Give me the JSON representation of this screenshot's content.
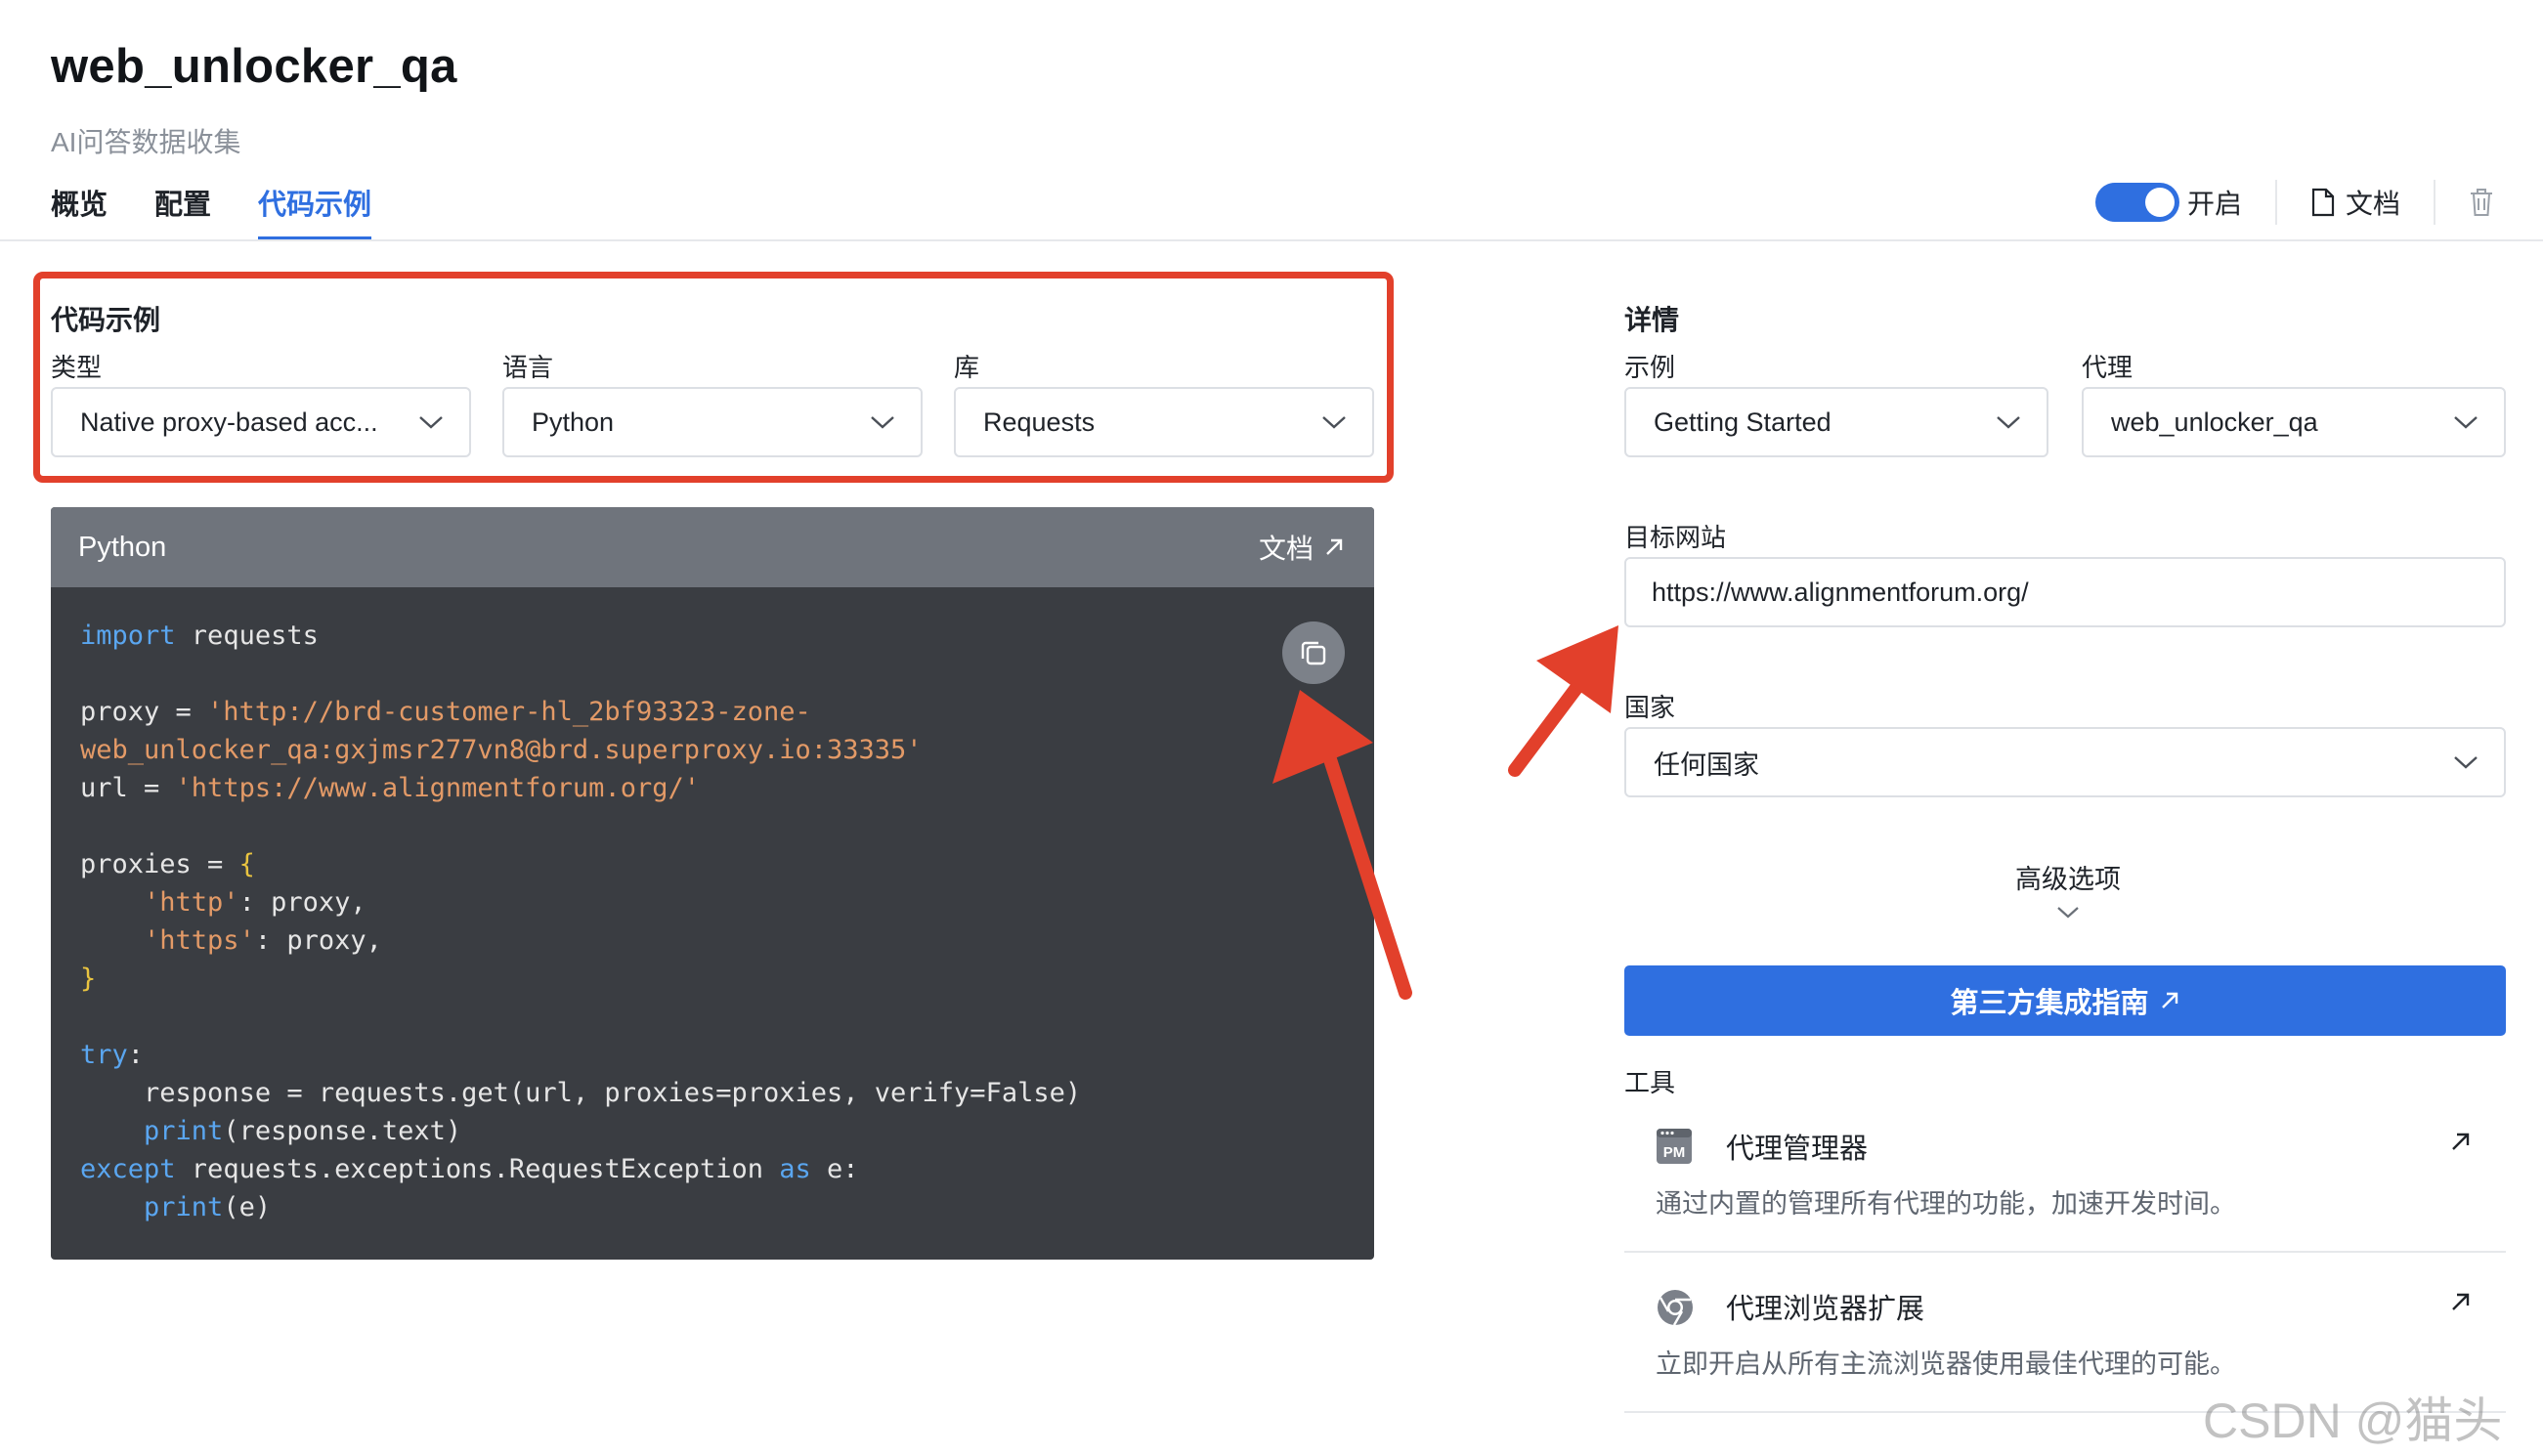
{
  "page": {
    "title": "web_unlocker_qa",
    "subtitle": "AI问答数据收集"
  },
  "tabs": [
    {
      "label": "概览"
    },
    {
      "label": "配置"
    },
    {
      "label": "代码示例"
    }
  ],
  "header_actions": {
    "toggle_label": "开启",
    "toggle_on": true,
    "doc_label": "文档"
  },
  "code_example": {
    "section_title": "代码示例",
    "type_label": "类型",
    "type_value": "Native proxy-based acc...",
    "language_label": "语言",
    "language_value": "Python",
    "library_label": "库",
    "library_value": "Requests",
    "panel_lang": "Python",
    "panel_doc_label": "文档",
    "code": {
      "l1_kw": "import",
      "l1_rest": " requests",
      "l3_a": "proxy = ",
      "l3_str": "'http://brd-customer-hl_2bf93323-zone-",
      "l4_str": "web_unlocker_qa:gxjmsr277vn8@brd.superproxy.io:33335'",
      "l5_a": "url = ",
      "l5_str": "'https://www.alignmentforum.org/'",
      "l7_a": "proxies = ",
      "l7_br": "{",
      "l8_str": "'http'",
      "l8_rest": ": proxy,",
      "l9_str": "'https'",
      "l9_rest": ": proxy,",
      "l10_br": "}",
      "l12_kw": "try",
      "l12_rest": ":",
      "l13": "response = requests.get(url, proxies=proxies, verify=False)",
      "l14_kw": "print",
      "l14_rest": "(response.text)",
      "l15_kw": "except",
      "l15_a": " requests.exceptions.RequestException ",
      "l15_kw2": "as",
      "l15_b": " e:",
      "l16_kw": "print",
      "l16_rest": "(e)"
    }
  },
  "details": {
    "section_title": "详情",
    "example_label": "示例",
    "example_value": "Getting Started",
    "proxy_label": "代理",
    "proxy_value": "web_unlocker_qa",
    "target_label": "目标网站",
    "target_value": "https://www.alignmentforum.org/",
    "country_label": "国家",
    "country_value": "任何国家",
    "advanced_label": "高级选项",
    "integration_button": "第三方集成指南",
    "tools_label": "工具",
    "tools": [
      {
        "name": "代理管理器",
        "desc": "通过内置的管理所有代理的功能，加速开发时间。",
        "icon": "pm-icon"
      },
      {
        "name": "代理浏览器扩展",
        "desc": "立即开启从所有主流浏览器使用最佳代理的可能。",
        "icon": "chrome-icon"
      }
    ]
  },
  "watermark": "CSDN @猫头虎",
  "colors": {
    "accent": "#2f6fe0",
    "annotation": "#e2402b",
    "code_bg": "#3a3d42",
    "code_header": "#6f747c"
  }
}
